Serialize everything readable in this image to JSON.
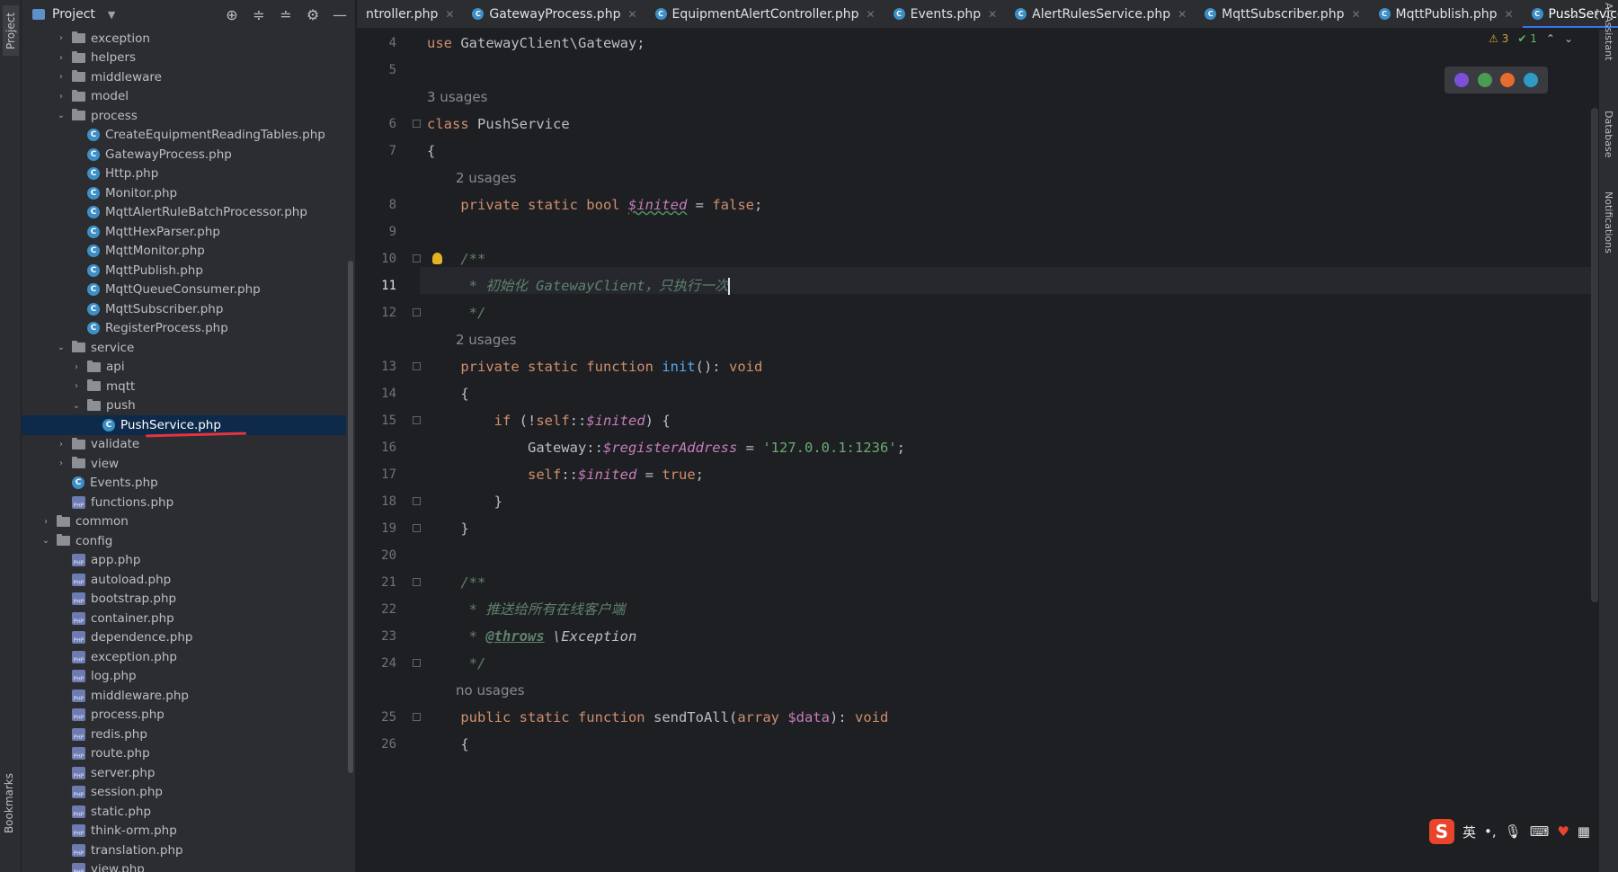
{
  "left_strip": {
    "project_label": "Project",
    "bookmarks_label": "Bookmarks"
  },
  "project_panel": {
    "title": "Project",
    "tree": [
      {
        "label": "exception",
        "type": "folder",
        "depth": 2,
        "expanded": false
      },
      {
        "label": "helpers",
        "type": "folder",
        "depth": 2,
        "expanded": false
      },
      {
        "label": "middleware",
        "type": "folder",
        "depth": 2,
        "expanded": false
      },
      {
        "label": "model",
        "type": "folder",
        "depth": 2,
        "expanded": false
      },
      {
        "label": "process",
        "type": "folder",
        "depth": 2,
        "expanded": true
      },
      {
        "label": "CreateEquipmentReadingTables.php",
        "type": "class",
        "depth": 3
      },
      {
        "label": "GatewayProcess.php",
        "type": "class",
        "depth": 3
      },
      {
        "label": "Http.php",
        "type": "class",
        "depth": 3
      },
      {
        "label": "Monitor.php",
        "type": "class",
        "depth": 3
      },
      {
        "label": "MqttAlertRuleBatchProcessor.php",
        "type": "class",
        "depth": 3
      },
      {
        "label": "MqttHexParser.php",
        "type": "class",
        "depth": 3
      },
      {
        "label": "MqttMonitor.php",
        "type": "class",
        "depth": 3
      },
      {
        "label": "MqttPublish.php",
        "type": "class",
        "depth": 3
      },
      {
        "label": "MqttQueueConsumer.php",
        "type": "class",
        "depth": 3
      },
      {
        "label": "MqttSubscriber.php",
        "type": "class",
        "depth": 3
      },
      {
        "label": "RegisterProcess.php",
        "type": "class",
        "depth": 3
      },
      {
        "label": "service",
        "type": "folder",
        "depth": 2,
        "expanded": true
      },
      {
        "label": "api",
        "type": "folder",
        "depth": 3,
        "expanded": false
      },
      {
        "label": "mqtt",
        "type": "folder",
        "depth": 3,
        "expanded": false
      },
      {
        "label": "push",
        "type": "folder",
        "depth": 3,
        "expanded": true
      },
      {
        "label": "PushService.php",
        "type": "class",
        "depth": 4,
        "selected": true
      },
      {
        "label": "validate",
        "type": "folder",
        "depth": 2,
        "expanded": false
      },
      {
        "label": "view",
        "type": "folder",
        "depth": 2,
        "expanded": false
      },
      {
        "label": "Events.php",
        "type": "class",
        "depth": 2
      },
      {
        "label": "functions.php",
        "type": "php",
        "depth": 2
      },
      {
        "label": "common",
        "type": "folder",
        "depth": 1,
        "expanded": false
      },
      {
        "label": "config",
        "type": "folder",
        "depth": 1,
        "expanded": true
      },
      {
        "label": "app.php",
        "type": "php",
        "depth": 2
      },
      {
        "label": "autoload.php",
        "type": "php",
        "depth": 2
      },
      {
        "label": "bootstrap.php",
        "type": "php",
        "depth": 2
      },
      {
        "label": "container.php",
        "type": "php",
        "depth": 2
      },
      {
        "label": "dependence.php",
        "type": "php",
        "depth": 2
      },
      {
        "label": "exception.php",
        "type": "php",
        "depth": 2
      },
      {
        "label": "log.php",
        "type": "php",
        "depth": 2
      },
      {
        "label": "middleware.php",
        "type": "php",
        "depth": 2
      },
      {
        "label": "process.php",
        "type": "php",
        "depth": 2
      },
      {
        "label": "redis.php",
        "type": "php",
        "depth": 2
      },
      {
        "label": "route.php",
        "type": "php",
        "depth": 2
      },
      {
        "label": "server.php",
        "type": "php",
        "depth": 2
      },
      {
        "label": "session.php",
        "type": "php",
        "depth": 2
      },
      {
        "label": "static.php",
        "type": "php",
        "depth": 2
      },
      {
        "label": "think-orm.php",
        "type": "php",
        "depth": 2
      },
      {
        "label": "translation.php",
        "type": "php",
        "depth": 2
      },
      {
        "label": "view.php",
        "type": "php",
        "depth": 2
      }
    ]
  },
  "tabs": [
    {
      "label": "ntroller.php",
      "icon": false
    },
    {
      "label": "GatewayProcess.php",
      "icon": true
    },
    {
      "label": "EquipmentAlertController.php",
      "icon": true
    },
    {
      "label": "Events.php",
      "icon": true
    },
    {
      "label": "AlertRulesService.php",
      "icon": true
    },
    {
      "label": "MqttSubscriber.php",
      "icon": true
    },
    {
      "label": "MqttPublish.php",
      "icon": true
    },
    {
      "label": "PushService.php",
      "icon": true,
      "active": true
    }
  ],
  "inspections": {
    "warnings": "3",
    "ok": "1"
  },
  "right_strip": {
    "ai": "AI Assistant",
    "database": "Database",
    "notifications": "Notifications"
  },
  "ime": {
    "lang": "英",
    "punct": "•,"
  },
  "code": {
    "lines": [
      {
        "n": "4",
        "html": "<span class='kw'>use</span> <span class='plain'>GatewayClient\\Gateway;</span>"
      },
      {
        "n": "5",
        "html": ""
      },
      {
        "usage": "3 usages"
      },
      {
        "n": "6",
        "html": "<span class='kw'>class</span> <span class='plain'>PushService</span>"
      },
      {
        "n": "7",
        "html": "<span class='plain'>{</span>"
      },
      {
        "usage": "2 usages",
        "indent": 1
      },
      {
        "n": "8",
        "html": "    <span class='kw'>private static bool</span> <span class='var wavy'>$inited</span> <span class='plain'>=</span> <span class='kw'>false</span><span class='plain'>;</span>"
      },
      {
        "n": "9",
        "html": ""
      },
      {
        "n": "10",
        "html": "    <span class='cmt'>/**</span>"
      },
      {
        "n": "11",
        "html": "     <span class='cmt'>* 初始化 GatewayClient，只执行一次</span><span class='caret'></span>",
        "current": true
      },
      {
        "n": "12",
        "html": "     <span class='cmt'>*/</span>"
      },
      {
        "usage": "2 usages",
        "indent": 1
      },
      {
        "n": "13",
        "html": "    <span class='kw'>private static function</span> <span class='fn'>init</span><span class='plain'>():</span> <span class='kw'>void</span>"
      },
      {
        "n": "14",
        "html": "    <span class='plain'>{</span>"
      },
      {
        "n": "15",
        "html": "        <span class='kw'>if</span> <span class='plain'>(!</span><span class='kw'>self</span><span class='plain'>::</span><span class='var'>$inited</span><span class='plain'>) {</span>"
      },
      {
        "n": "16",
        "html": "            <span class='plain'>Gateway::</span><span class='var'>$registerAddress</span> <span class='plain'>=</span> <span class='str'>'127.0.0.1:1236'</span><span class='plain'>;</span>"
      },
      {
        "n": "17",
        "html": "            <span class='kw'>self</span><span class='plain'>::</span><span class='var'>$inited</span> <span class='plain'>=</span> <span class='kw'>true</span><span class='plain'>;</span>"
      },
      {
        "n": "18",
        "html": "        <span class='plain'>}</span>"
      },
      {
        "n": "19",
        "html": "    <span class='plain'>}</span>"
      },
      {
        "n": "20",
        "html": ""
      },
      {
        "n": "21",
        "html": "    <span class='cmt'>/**</span>"
      },
      {
        "n": "22",
        "html": "     <span class='cmt'>* 推送给所有在线客户端</span>"
      },
      {
        "n": "23",
        "html": "     <span class='cmt'>* </span><span class='tag'>@throws</span> <span class='plain' style='font-style:italic'>\\Exception</span>"
      },
      {
        "n": "24",
        "html": "     <span class='cmt'>*/</span>"
      },
      {
        "usage": "no usages",
        "indent": 1
      },
      {
        "n": "25",
        "html": "    <span class='kw'>public static function</span> <span class='fn2'>sendToAll</span><span class='plain'>(</span><span class='kw'>array</span> <span class='var' style='font-style:normal'>$data</span><span class='plain'>):</span> <span class='kw'>void</span>"
      },
      {
        "n": "26",
        "html": "    <span class='plain'>{</span>"
      }
    ]
  }
}
